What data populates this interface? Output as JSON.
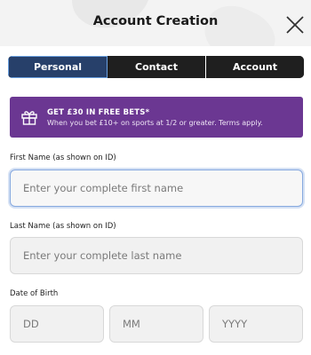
{
  "header": {
    "title": "Account Creation"
  },
  "tabs": [
    {
      "label": "Personal"
    },
    {
      "label": "Contact"
    },
    {
      "label": "Account"
    }
  ],
  "promo": {
    "heading": "GET £30 IN FREE BETS*",
    "subtext": "When you bet £10+ on sports at 1/2 or greater. Terms apply."
  },
  "form": {
    "first_name": {
      "label": "First Name (as shown on ID)",
      "placeholder": "Enter your complete first name",
      "value": ""
    },
    "last_name": {
      "label": "Last Name (as shown on ID)",
      "placeholder": "Enter your complete last name",
      "value": ""
    },
    "dob": {
      "label": "Date of Birth",
      "day_placeholder": "DD",
      "month_placeholder": "MM",
      "year_placeholder": "YYYY"
    }
  },
  "colors": {
    "tab_active": "#27406a",
    "tab_inactive": "#1f1f1f",
    "promo_bg": "#6b3792",
    "focus_ring": "#86a9df"
  }
}
